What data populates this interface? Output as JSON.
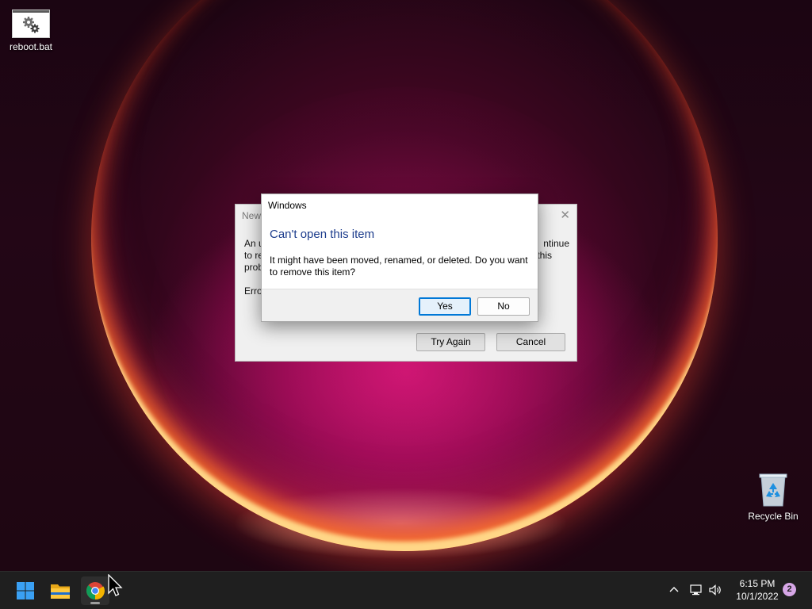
{
  "desktop": {
    "icons": [
      {
        "label": "reboot.bat",
        "icon": "batch-file-gear-icon"
      },
      {
        "label": "Recycle Bin",
        "icon": "recycle-bin-icon"
      }
    ]
  },
  "back_dialog": {
    "title": "New",
    "line1_left": "An u",
    "line1_right": "ntinue",
    "line2_left": "to re",
    "line2_right": "this",
    "line3_left": "prob",
    "error_label": "Erro",
    "buttons": {
      "try_again": "Try Again",
      "cancel": "Cancel"
    },
    "close_icon": "close-icon"
  },
  "front_dialog": {
    "title": "Windows",
    "heading": "Can't open this item",
    "message": "It might have been moved, renamed, or deleted. Do you want to remove this item?",
    "buttons": {
      "yes": "Yes",
      "no": "No"
    }
  },
  "taskbar": {
    "pinned": [
      {
        "name": "Start",
        "icon": "windows-logo-icon"
      },
      {
        "name": "File Explorer",
        "icon": "folder-icon"
      },
      {
        "name": "Google Chrome",
        "icon": "chrome-icon",
        "active": true
      }
    ],
    "tray": {
      "icons": [
        "chevron-up-icon",
        "network-icon",
        "volume-icon"
      ],
      "time": "6:15 PM",
      "date": "10/1/2022",
      "notification_count": "2"
    }
  },
  "colors": {
    "accent": "#0078d7",
    "dialog_heading": "#1c3c8c",
    "taskbar": "#1f1f1f"
  }
}
